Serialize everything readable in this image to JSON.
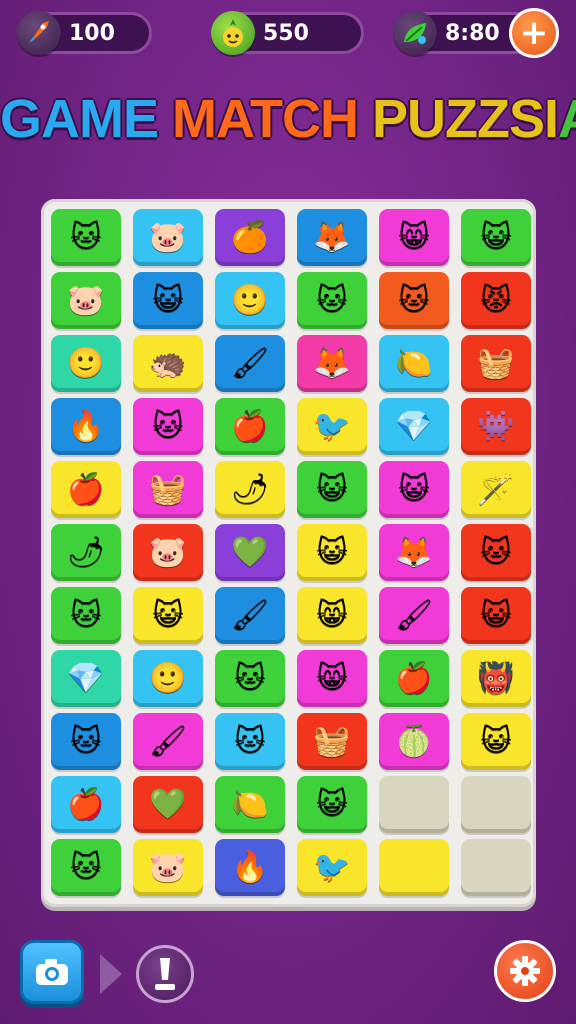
{
  "topbar": {
    "stat_a": {
      "value": "100",
      "icon": "rocket-icon"
    },
    "stat_b": {
      "value": "550",
      "icon": "pineapple-icon"
    },
    "stat_c": {
      "value": "8:80",
      "icon": "leaf-energy-icon"
    },
    "add_button_icon": "plus-icon"
  },
  "title": {
    "parts": [
      {
        "text": "GAME ",
        "color": "#2aa9f0"
      },
      {
        "text": "MATCH ",
        "color": "#ff6a1a"
      },
      {
        "text": "PUZZSI",
        "color": "#e6c21a"
      },
      {
        "text": "A",
        "color": "#43c43a"
      }
    ]
  },
  "board": {
    "rows": [
      [
        {
          "bg": "#3fd13a",
          "icon": "cat-face",
          "glyph": "🐱"
        },
        {
          "bg": "#34c3f2",
          "icon": "pink-cat-face",
          "glyph": "🐷"
        },
        {
          "bg": "#8a3fd8",
          "icon": "orange-fruit",
          "glyph": "🍊"
        },
        {
          "bg": "#1e8fe0",
          "icon": "fox-face",
          "glyph": "🦊"
        },
        {
          "bg": "#f23ad6",
          "icon": "winking-cat-face",
          "glyph": "😸"
        },
        {
          "bg": "#3fd13a",
          "icon": "green-cat-face",
          "glyph": "😺"
        }
      ],
      [
        {
          "bg": "#3fd13a",
          "icon": "pink-cat-face",
          "glyph": "🐷"
        },
        {
          "bg": "#1e8fe0",
          "icon": "blue-cat-face",
          "glyph": "😺"
        },
        {
          "bg": "#34c3f2",
          "icon": "yellow-smiley",
          "glyph": "🙂"
        },
        {
          "bg": "#3fd13a",
          "icon": "yellow-cat-face",
          "glyph": "🐱"
        },
        {
          "bg": "#f25a1e",
          "icon": "yellow-cat-face",
          "glyph": "🐱"
        },
        {
          "bg": "#f2361e",
          "icon": "red-cat-face",
          "glyph": "😾"
        }
      ],
      [
        {
          "bg": "#2fd6a8",
          "icon": "yellow-smiley",
          "glyph": "🙂"
        },
        {
          "bg": "#f9e52a",
          "icon": "spiky-orange-face",
          "glyph": "🦔"
        },
        {
          "bg": "#1e8fe0",
          "icon": "paint-brush",
          "glyph": "🖌"
        },
        {
          "bg": "#f23aa8",
          "icon": "fox-face",
          "glyph": "🦊"
        },
        {
          "bg": "#34c3f2",
          "icon": "lemon-face",
          "glyph": "🍋"
        },
        {
          "bg": "#f2361e",
          "icon": "basket",
          "glyph": "🧺"
        }
      ],
      [
        {
          "bg": "#1e8fe0",
          "icon": "fire-face",
          "glyph": "🔥"
        },
        {
          "bg": "#f23ad6",
          "icon": "yellow-cat-face",
          "glyph": "🐱"
        },
        {
          "bg": "#3fd13a",
          "icon": "red-apple",
          "glyph": "🍎"
        },
        {
          "bg": "#f9e52a",
          "icon": "red-bird",
          "glyph": "🐦"
        },
        {
          "bg": "#34c3f2",
          "icon": "red-diamond",
          "glyph": "💎"
        },
        {
          "bg": "#f2361e",
          "icon": "purple-monster",
          "glyph": "👾"
        }
      ],
      [
        {
          "bg": "#f9e52a",
          "icon": "red-apple",
          "glyph": "🍎"
        },
        {
          "bg": "#f23ad6",
          "icon": "basket",
          "glyph": "🧺"
        },
        {
          "bg": "#f9e52a",
          "icon": "chili-pepper",
          "glyph": "🌶"
        },
        {
          "bg": "#3fd13a",
          "icon": "green-cat-face",
          "glyph": "😺"
        },
        {
          "bg": "#f23ad6",
          "icon": "blue-cat-face",
          "glyph": "😺"
        },
        {
          "bg": "#f9e52a",
          "icon": "magic-wand",
          "glyph": "🪄"
        }
      ],
      [
        {
          "bg": "#3fd13a",
          "icon": "chili-pepper",
          "glyph": "🌶"
        },
        {
          "bg": "#f2361e",
          "icon": "pink-cat-face",
          "glyph": "🐷"
        },
        {
          "bg": "#8a3fd8",
          "icon": "green-heart",
          "glyph": "💚"
        },
        {
          "bg": "#f9e52a",
          "icon": "blue-cat-face",
          "glyph": "😺"
        },
        {
          "bg": "#f23ad6",
          "icon": "fox-face",
          "glyph": "🦊"
        },
        {
          "bg": "#f2361e",
          "icon": "yellow-cat-face",
          "glyph": "🐱"
        }
      ],
      [
        {
          "bg": "#3fd13a",
          "icon": "orange-cat-face",
          "glyph": "🐱"
        },
        {
          "bg": "#f9e52a",
          "icon": "blue-cat-face",
          "glyph": "😺"
        },
        {
          "bg": "#1e8fe0",
          "icon": "paint-brush",
          "glyph": "🖌"
        },
        {
          "bg": "#f9e52a",
          "icon": "orange-cat-face",
          "glyph": "😸"
        },
        {
          "bg": "#f23ad6",
          "icon": "paint-brush",
          "glyph": "🖌"
        },
        {
          "bg": "#f2361e",
          "icon": "green-cat-face",
          "glyph": "😺"
        }
      ],
      [
        {
          "bg": "#2fd6a8",
          "icon": "red-diamond",
          "glyph": "💎"
        },
        {
          "bg": "#34c3f2",
          "icon": "yellow-smiley",
          "glyph": "🙂"
        },
        {
          "bg": "#3fd13a",
          "icon": "cat-face",
          "glyph": "🐱"
        },
        {
          "bg": "#f23ad6",
          "icon": "yellow-cat-face",
          "glyph": "😸"
        },
        {
          "bg": "#3fd13a",
          "icon": "red-apple",
          "glyph": "🍎"
        },
        {
          "bg": "#f9e52a",
          "icon": "pink-monster",
          "glyph": "👹"
        }
      ],
      [
        {
          "bg": "#1e8fe0",
          "icon": "yellow-cat-face",
          "glyph": "🐱"
        },
        {
          "bg": "#f23ad6",
          "icon": "paint-brush",
          "glyph": "🖌"
        },
        {
          "bg": "#34c3f2",
          "icon": "cat-face",
          "glyph": "🐱"
        },
        {
          "bg": "#f2361e",
          "icon": "basket",
          "glyph": "🧺"
        },
        {
          "bg": "#f23ad6",
          "icon": "green-lemon",
          "glyph": "🍈"
        },
        {
          "bg": "#f9e52a",
          "icon": "blue-cat-face",
          "glyph": "😺"
        }
      ],
      [
        {
          "bg": "#34c3f2",
          "icon": "red-apple",
          "glyph": "🍎"
        },
        {
          "bg": "#f2361e",
          "icon": "green-heart",
          "glyph": "💚"
        },
        {
          "bg": "#3fd13a",
          "icon": "yellow-fruit",
          "glyph": "🍋"
        },
        {
          "bg": "#3fd13a",
          "icon": "blue-cat-face",
          "glyph": "😺"
        },
        {
          "bg": "#d9d6bf",
          "icon": "empty",
          "glyph": ""
        },
        {
          "bg": "#d9d6bf",
          "icon": "empty",
          "glyph": ""
        }
      ],
      [
        {
          "bg": "#3fd13a",
          "icon": "cat-face",
          "glyph": "🐱"
        },
        {
          "bg": "#f9e52a",
          "icon": "pink-monster",
          "glyph": "🐷"
        },
        {
          "bg": "#4a5fe0",
          "icon": "fire-face",
          "glyph": "🔥"
        },
        {
          "bg": "#f9e52a",
          "icon": "pink-bird",
          "glyph": "🐦"
        },
        {
          "bg": "#f9e52a",
          "icon": "empty",
          "glyph": ""
        },
        {
          "bg": "#d9d6bf",
          "icon": "empty",
          "glyph": ""
        }
      ]
    ]
  },
  "bottombar": {
    "camera_icon": "camera-icon",
    "arrow_icon": "play-arrow-icon",
    "hint_icon": "exclamation-icon",
    "settings_icon": "gear-icon"
  }
}
